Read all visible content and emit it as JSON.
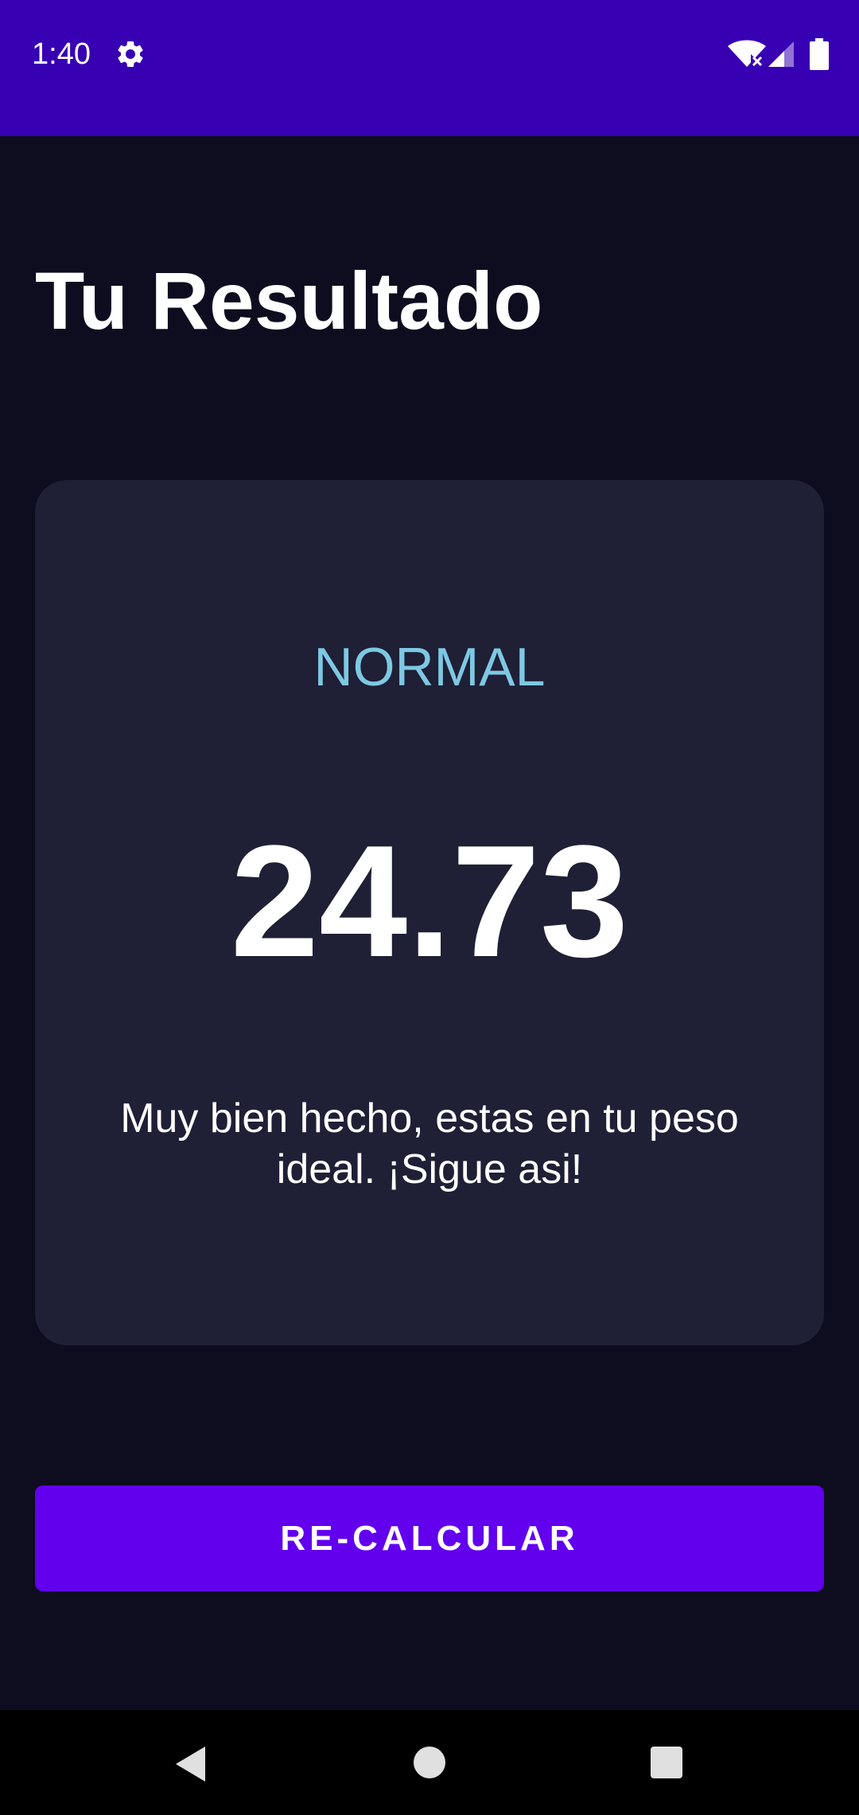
{
  "status_bar": {
    "time": "1:40",
    "background_color": "#3700B3",
    "icons": [
      "gear-icon",
      "wifi-icon",
      "signal-icon",
      "battery-icon"
    ]
  },
  "page": {
    "title": "Tu Resultado",
    "background_color": "#0E0C1F"
  },
  "result": {
    "category": "NORMAL",
    "category_color": "#7EC8E3",
    "value": "24.73",
    "message": "Muy bien hecho, estas en tu peso ideal. ¡Sigue asi!",
    "card_color": "#1F1F35"
  },
  "actions": {
    "recalculate_label": "RE-CALCULAR",
    "button_color": "#6200EE"
  },
  "nav_bar": {
    "icons": [
      "back-icon",
      "home-icon",
      "recents-icon"
    ]
  }
}
